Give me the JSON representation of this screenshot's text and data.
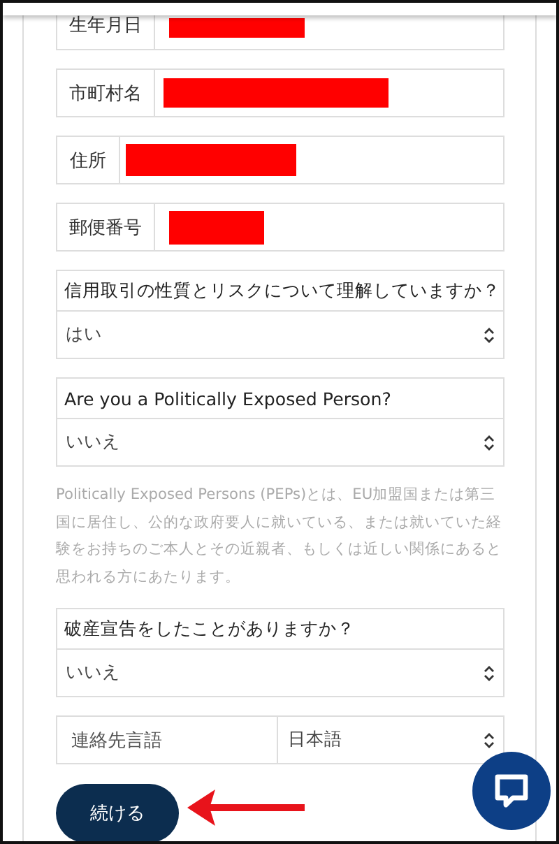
{
  "fields": [
    {
      "label": "生年月日",
      "redacted": true
    },
    {
      "label": "市町村名",
      "redacted": true
    },
    {
      "label": "住所",
      "redacted": true
    },
    {
      "label": "郵便番号",
      "redacted": true
    }
  ],
  "questions": [
    {
      "question": "信用取引の性質とリスクについて理解していますか？",
      "value": "はい"
    },
    {
      "question": "Are you a Politically Exposed Person?",
      "value": "いいえ",
      "help": "Politically Exposed Persons (PEPs)とは、EU加盟国または第三国に居住し、公的な政府要人に就いている、または就いていた経験をお持ちのご本人とその近親者、もしくは近しい関係にあると思われる方にあたります。"
    },
    {
      "question": "破産宣告をしたことがありますか？",
      "value": "いいえ"
    }
  ],
  "language": {
    "label": "連絡先言語",
    "value": "日本語"
  },
  "continue_button": "続ける"
}
